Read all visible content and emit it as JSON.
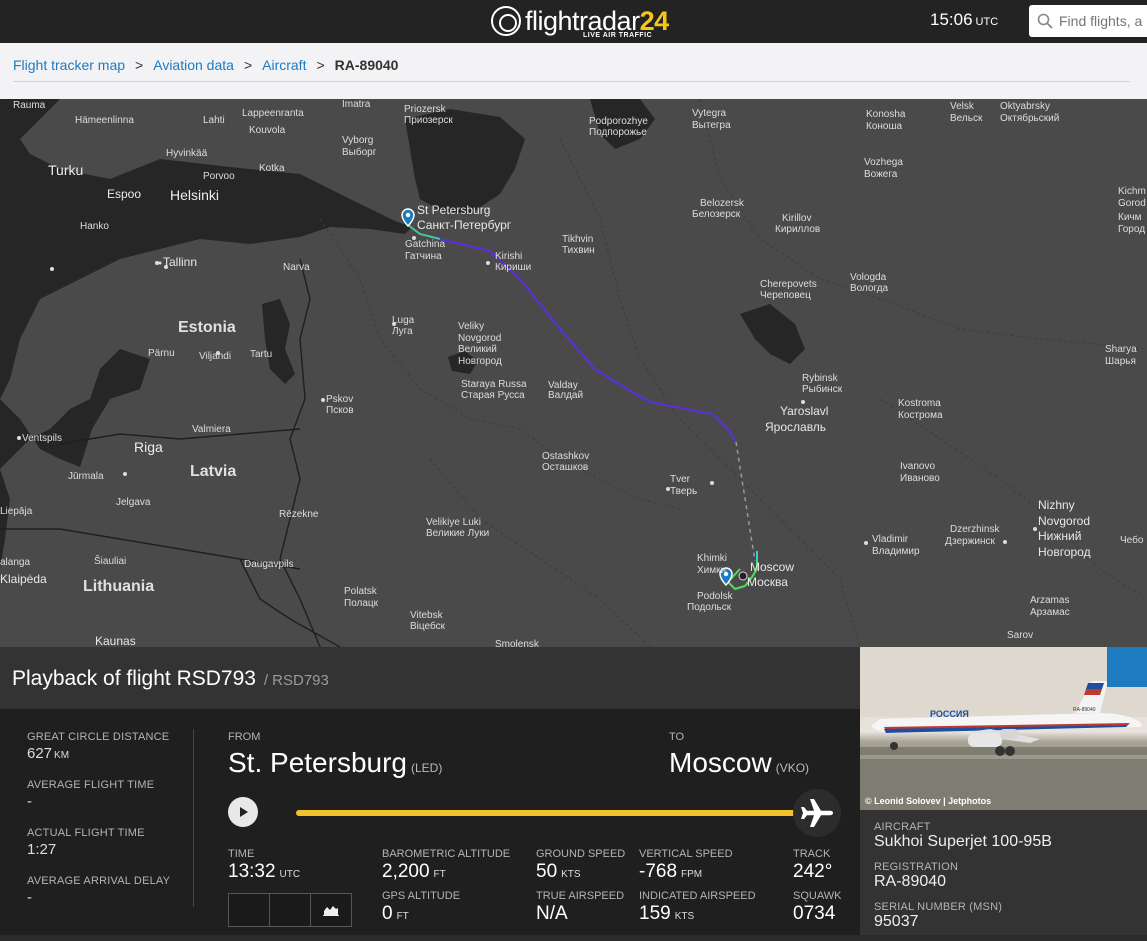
{
  "header": {
    "logo_text": "flightradar",
    "logo_num": "24",
    "logo_sub": "LIVE AIR TRAFFIC",
    "time": "15:06",
    "time_zone": "UTC",
    "search_placeholder": "Find flights, a"
  },
  "breadcrumb": {
    "items": [
      "Flight tracker map",
      "Aviation data",
      "Aircraft"
    ],
    "separator": ">",
    "current": "RA-89040"
  },
  "map": {
    "labels": [
      {
        "text": "Rauma",
        "cls": ""
      },
      {
        "text": "Hämeenlinna",
        "cls": ""
      },
      {
        "text": "Lahti",
        "cls": ""
      },
      {
        "text": "Lappeenranta",
        "cls": ""
      },
      {
        "text": "Kouvola",
        "cls": ""
      },
      {
        "text": "Imatra",
        "cls": ""
      },
      {
        "text": "Hyvinkää",
        "cls": ""
      },
      {
        "text": "Porvoo",
        "cls": ""
      },
      {
        "text": "Kotka",
        "cls": ""
      },
      {
        "text": "Vyborg",
        "cls": ""
      },
      {
        "text": "Выборг",
        "cls": ""
      },
      {
        "text": "Turku",
        "cls": "city"
      },
      {
        "text": "Espoo",
        "cls": "med"
      },
      {
        "text": "Helsinki",
        "cls": "city"
      },
      {
        "text": "Hanko",
        "cls": ""
      },
      {
        "text": "Priozersk",
        "cls": ""
      },
      {
        "text": "Приозерск",
        "cls": ""
      },
      {
        "text": "Podporozhye",
        "cls": ""
      },
      {
        "text": "Подпорожье",
        "cls": ""
      },
      {
        "text": "Vytegra",
        "cls": ""
      },
      {
        "text": "Вытегра",
        "cls": ""
      },
      {
        "text": "Konosha",
        "cls": ""
      },
      {
        "text": "Коноша",
        "cls": ""
      },
      {
        "text": "Velsk",
        "cls": ""
      },
      {
        "text": "Вельск",
        "cls": ""
      },
      {
        "text": "Oktyabrsky",
        "cls": ""
      },
      {
        "text": "Октябрьский",
        "cls": ""
      },
      {
        "text": "Vozhega",
        "cls": ""
      },
      {
        "text": "Вожега",
        "cls": ""
      },
      {
        "text": "St Petersburg",
        "cls": "med"
      },
      {
        "text": "Санкт-Петербург",
        "cls": "med"
      },
      {
        "text": "Gatchina",
        "cls": ""
      },
      {
        "text": "Гатчина",
        "cls": ""
      },
      {
        "text": "Kirishi",
        "cls": ""
      },
      {
        "text": "Кириши",
        "cls": ""
      },
      {
        "text": "Tikhvin",
        "cls": ""
      },
      {
        "text": "Тихвин",
        "cls": ""
      },
      {
        "text": "Belozersk",
        "cls": ""
      },
      {
        "text": "Белозерск",
        "cls": ""
      },
      {
        "text": "Kirillov",
        "cls": ""
      },
      {
        "text": "Кириллов",
        "cls": ""
      },
      {
        "text": "Tallinn",
        "cls": "med"
      },
      {
        "text": "Narva",
        "cls": ""
      },
      {
        "text": "Cherepovets",
        "cls": ""
      },
      {
        "text": "Череповец",
        "cls": ""
      },
      {
        "text": "Vologda",
        "cls": ""
      },
      {
        "text": "Вологда",
        "cls": ""
      },
      {
        "text": "Estonia",
        "cls": "big"
      },
      {
        "text": "Luga",
        "cls": ""
      },
      {
        "text": "Луга",
        "cls": ""
      },
      {
        "text": "Veliky",
        "cls": ""
      },
      {
        "text": "Novgorod",
        "cls": ""
      },
      {
        "text": "Великий",
        "cls": ""
      },
      {
        "text": "Новгород",
        "cls": ""
      },
      {
        "text": "Pärnu",
        "cls": ""
      },
      {
        "text": "Viljandi",
        "cls": ""
      },
      {
        "text": "Tartu",
        "cls": ""
      },
      {
        "text": "Staraya Russa",
        "cls": ""
      },
      {
        "text": "Старая Русса",
        "cls": ""
      },
      {
        "text": "Valday",
        "cls": ""
      },
      {
        "text": "Валдай",
        "cls": ""
      },
      {
        "text": "Rybinsk",
        "cls": ""
      },
      {
        "text": "Рыбинск",
        "cls": ""
      },
      {
        "text": "Kostroma",
        "cls": ""
      },
      {
        "text": "Кострома",
        "cls": ""
      },
      {
        "text": "Sharya",
        "cls": ""
      },
      {
        "text": "Шарья",
        "cls": ""
      },
      {
        "text": "Pskov",
        "cls": ""
      },
      {
        "text": "Псков",
        "cls": ""
      },
      {
        "text": "Yaroslavl",
        "cls": "med"
      },
      {
        "text": "Ярославль",
        "cls": "med"
      },
      {
        "text": "Ventspils",
        "cls": ""
      },
      {
        "text": "Valmiera",
        "cls": ""
      },
      {
        "text": "Ostashkov",
        "cls": ""
      },
      {
        "text": "Осташков",
        "cls": ""
      },
      {
        "text": "Latvia",
        "cls": "big"
      },
      {
        "text": "Riga",
        "cls": "city"
      },
      {
        "text": "Jūrmala",
        "cls": ""
      },
      {
        "text": "Jelgava",
        "cls": ""
      },
      {
        "text": "Tver",
        "cls": ""
      },
      {
        "text": "Тверь",
        "cls": ""
      },
      {
        "text": "Ivanovo",
        "cls": ""
      },
      {
        "text": "Иваново",
        "cls": ""
      },
      {
        "text": "Liepāja",
        "cls": ""
      },
      {
        "text": "Rēzekne",
        "cls": ""
      },
      {
        "text": "Nizhny",
        "cls": "med"
      },
      {
        "text": "Novgorod",
        "cls": "med"
      },
      {
        "text": "Нижний",
        "cls": "med"
      },
      {
        "text": "Новгород",
        "cls": "med"
      },
      {
        "text": "Velikiye Luki",
        "cls": ""
      },
      {
        "text": "Великие Луки",
        "cls": ""
      },
      {
        "text": "Dzerzhinsk",
        "cls": ""
      },
      {
        "text": "Дзержинск",
        "cls": ""
      },
      {
        "text": "Vladimir",
        "cls": ""
      },
      {
        "text": "Владимир",
        "cls": ""
      },
      {
        "text": "Khimki",
        "cls": ""
      },
      {
        "text": "Химки",
        "cls": ""
      },
      {
        "text": "Moscow",
        "cls": "med"
      },
      {
        "text": "Москва",
        "cls": "med"
      },
      {
        "text": "Šiauliai",
        "cls": ""
      },
      {
        "text": "Daugavpils",
        "cls": ""
      },
      {
        "text": "alanga",
        "cls": ""
      },
      {
        "text": "Klaipėda",
        "cls": "med"
      },
      {
        "text": "Lithuania",
        "cls": "big"
      },
      {
        "text": "Podolsk",
        "cls": ""
      },
      {
        "text": "Подольск",
        "cls": ""
      },
      {
        "text": "Polatsk",
        "cls": ""
      },
      {
        "text": "Полацк",
        "cls": ""
      },
      {
        "text": "Vitebsk",
        "cls": ""
      },
      {
        "text": "Віцебск",
        "cls": ""
      },
      {
        "text": "Arzamas",
        "cls": ""
      },
      {
        "text": "Арзамас",
        "cls": ""
      },
      {
        "text": "Kaunas",
        "cls": "med"
      },
      {
        "text": "Smolensk",
        "cls": ""
      },
      {
        "text": "Sarov",
        "cls": ""
      },
      {
        "text": "Kichm",
        "cls": ""
      },
      {
        "text": "Gorod",
        "cls": ""
      },
      {
        "text": "Кичм",
        "cls": ""
      },
      {
        "text": "Город",
        "cls": ""
      },
      {
        "text": "Чебо",
        "cls": ""
      }
    ]
  },
  "playback": {
    "title": "Playback of flight RSD793",
    "subtitle": "/ RSD793"
  },
  "stats": [
    {
      "label": "GREAT CIRCLE DISTANCE",
      "value": "627",
      "unit": "KM"
    },
    {
      "label": "AVERAGE FLIGHT TIME",
      "value": "-",
      "unit": ""
    },
    {
      "label": "ACTUAL FLIGHT TIME",
      "value": "1:27",
      "unit": ""
    },
    {
      "label": "AVERAGE ARRIVAL DELAY",
      "value": "-",
      "unit": ""
    }
  ],
  "route": {
    "from_label": "FROM",
    "from_city": "St. Petersburg",
    "from_code": "(LED)",
    "to_label": "TO",
    "to_city": "Moscow",
    "to_code": "(VKO)",
    "progress": 1.0
  },
  "telemetry": {
    "time_label": "TIME",
    "time_value": "13:32",
    "time_unit": "UTC",
    "baro_label": "BAROMETRIC ALTITUDE",
    "baro_value": "2,200",
    "baro_unit": "FT",
    "gps_label": "GPS ALTITUDE",
    "gps_value": "0",
    "gps_unit": "FT",
    "gs_label": "GROUND SPEED",
    "gs_value": "50",
    "gs_unit": "KTS",
    "tas_label": "TRUE AIRSPEED",
    "tas_value": "N/A",
    "vs_label": "VERTICAL SPEED",
    "vs_value": "-768",
    "vs_unit": "FPM",
    "ias_label": "INDICATED AIRSPEED",
    "ias_value": "159",
    "ias_unit": "KTS",
    "track_label": "TRACK",
    "track_value": "242°",
    "squawk_label": "SQUAWK",
    "squawk_value": "0734"
  },
  "aircraft": {
    "photo_credit": "© Leonid Solovev | Jetphotos",
    "livery_text": "РОССИЯ",
    "reg_on_tail": "RA-89040",
    "aircraft_label": "AIRCRAFT",
    "aircraft_value": "Sukhoi Superjet 100-95B",
    "registration_label": "REGISTRATION",
    "registration_value": "RA-89040",
    "serial_label": "SERIAL NUMBER (MSN)",
    "serial_value": "95037"
  }
}
